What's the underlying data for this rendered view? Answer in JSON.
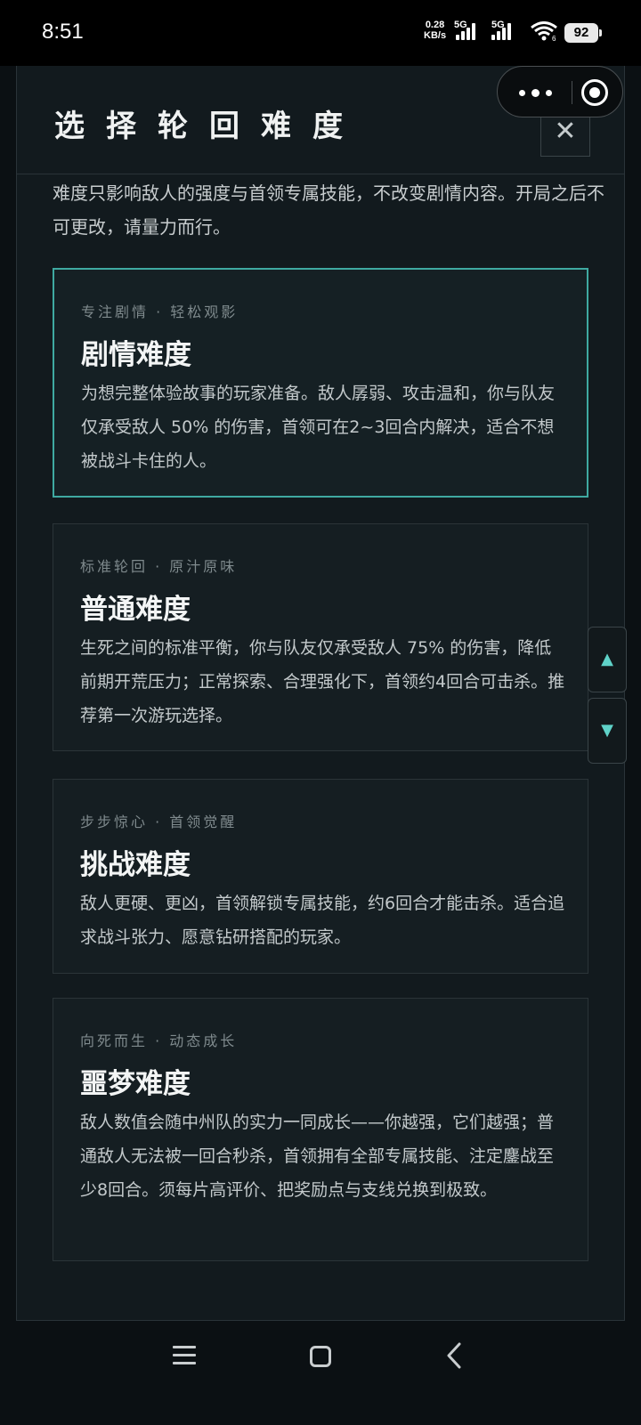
{
  "status_bar": {
    "time": "8:51",
    "net_speed": "0.28",
    "net_unit": "KB/s",
    "sim1_type": "5G",
    "sim2_type": "5G",
    "wifi_badge": "6",
    "battery": "92"
  },
  "dialog": {
    "title": "选择轮回难度",
    "close_label": "✕",
    "intro": "难度只影响敌人的强度与首领专属技能，不改变剧情内容。开局之后不可更改，请量力而行。",
    "difficulties": [
      {
        "tags": "专注剧情 · 轻松观影",
        "title": "剧情难度",
        "description": "为想完整体验故事的玩家准备。敌人孱弱、攻击温和，你与队友仅承受敌人 50% 的伤害，首领可在2~3回合内解决，适合不想被战斗卡住的人。",
        "selected": true
      },
      {
        "tags": "标准轮回 · 原汁原味",
        "title": "普通难度",
        "description": "生死之间的标准平衡，你与队友仅承受敌人 75% 的伤害，降低前期开荒压力；正常探索、合理强化下，首领约4回合可击杀。推荐第一次游玩选择。",
        "selected": false
      },
      {
        "tags": "步步惊心 · 首领觉醒",
        "title": "挑战难度",
        "description": "敌人更硬、更凶，首领解锁专属技能，约6回合才能击杀。适合追求战斗张力、愿意钻研搭配的玩家。",
        "selected": false
      },
      {
        "tags": "向死而生 · 动态成长",
        "title": "噩梦难度",
        "description": "敌人数值会随中州队的实力一同成长——你越强，它们越强；普通敌人无法被一回合秒杀，首领拥有全部专属技能、注定鏖战至少8回合。须每片高评价、把奖励点与支线兑换到极致。",
        "selected": false
      }
    ]
  },
  "scroll": {
    "up_label": "▲",
    "down_label": "▼"
  },
  "colors": {
    "accent": "#3fa9a1",
    "background": "#121a1e"
  }
}
